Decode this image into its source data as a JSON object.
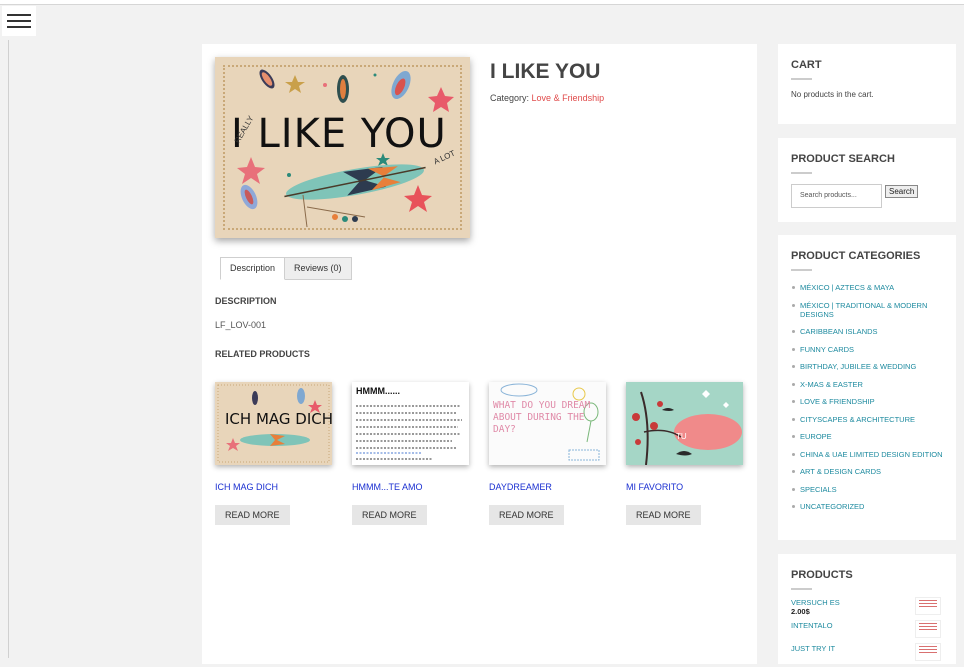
{
  "product": {
    "title": "I LIKE YOU",
    "category_label": "Category:",
    "category": "Love & Friendship",
    "image_text": {
      "main": "I LIKE YOU",
      "small_left": "REALLY",
      "small_right": "A LOT"
    }
  },
  "tabs": [
    {
      "label": "Description"
    },
    {
      "label": "Reviews (0)"
    }
  ],
  "description": {
    "heading": "DESCRIPTION",
    "sku": "LF_LOV-001"
  },
  "related": {
    "heading": "RELATED PRODUCTS",
    "items": [
      {
        "title": "ICH MAG DICH",
        "button": "READ MORE",
        "image_text": "ICH MAG DICH"
      },
      {
        "title": "HMMM...TE AMO",
        "button": "READ MORE",
        "image_text": "HMMM......"
      },
      {
        "title": "DAYDREAMER",
        "button": "READ MORE",
        "image_text": "WHAT DO YOU DREAM ABOUT DURING THE DAY?"
      },
      {
        "title": "MI FAVORITO",
        "button": "READ MORE",
        "image_text": "TU"
      }
    ]
  },
  "sidebar": {
    "cart": {
      "title": "CART",
      "empty_text": "No products in the cart."
    },
    "search": {
      "title": "PRODUCT SEARCH",
      "placeholder": "Search products...",
      "button": "Search"
    },
    "categories": {
      "title": "PRODUCT CATEGORIES",
      "items": [
        "MÉXICO | AZTECS & MAYA",
        "MÉXICO | TRADITIONAL & MODERN DESIGNS",
        "CARIBBEAN ISLANDS",
        "FUNNY CARDS",
        "BIRTHDAY, JUBILEE & WEDDING",
        "X-MAS & EASTER",
        "LOVE & FRIENDSHIP",
        "CITYSCAPES & ARCHITECTURE",
        "EUROPE",
        "CHINA & UAE LIMITED DESIGN EDITION",
        "ART & DESIGN CARDS",
        "SPECIALS",
        "UNCATEGORIZED"
      ]
    },
    "products": {
      "title": "PRODUCTS",
      "items": [
        {
          "name": "VERSUCH ES",
          "price": "2.00$"
        },
        {
          "name": "INTENTALO",
          "price": ""
        },
        {
          "name": "JUST TRY IT",
          "price": ""
        }
      ]
    }
  },
  "colors": {
    "accent": "#e04a4a",
    "link_teal": "#1d8a9f",
    "link_blue": "#1a2fd1",
    "card_beige": "#e8d5ba"
  }
}
